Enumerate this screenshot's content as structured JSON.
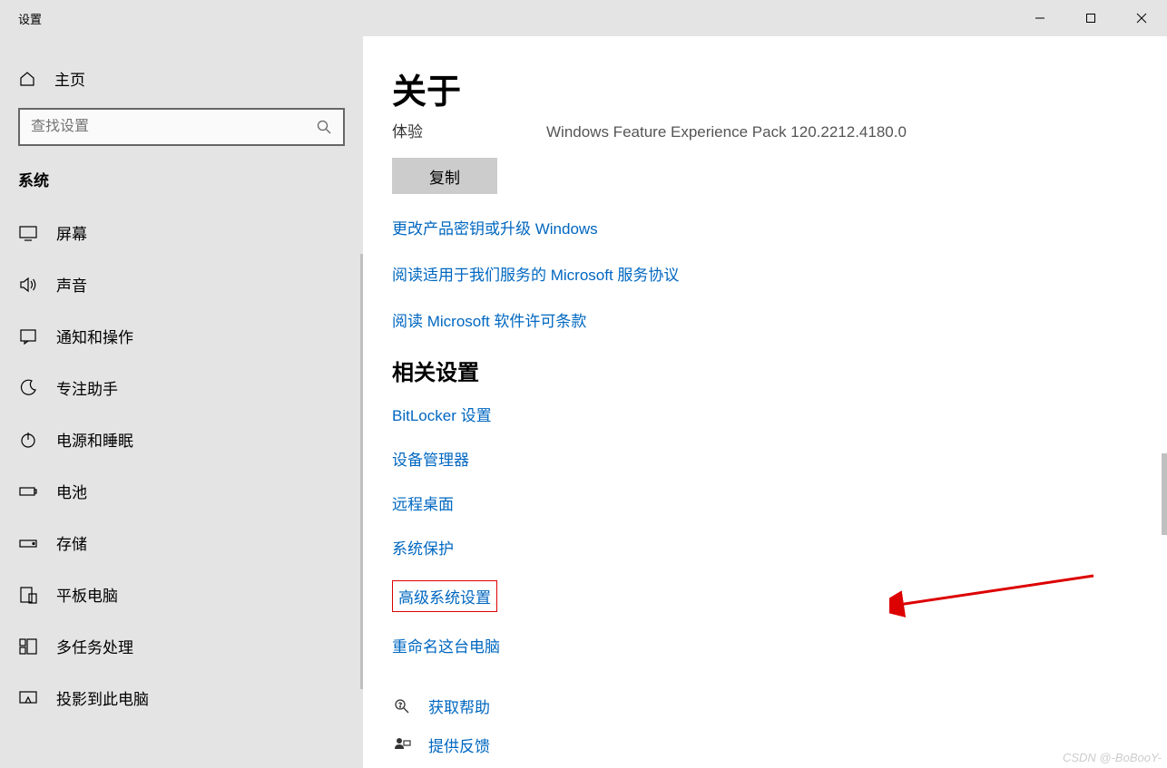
{
  "window": {
    "title": "设置"
  },
  "sidebar": {
    "home": "主页",
    "search_placeholder": "查找设置",
    "section": "系统",
    "items": [
      {
        "label": "屏幕"
      },
      {
        "label": "声音"
      },
      {
        "label": "通知和操作"
      },
      {
        "label": "专注助手"
      },
      {
        "label": "电源和睡眠"
      },
      {
        "label": "电池"
      },
      {
        "label": "存储"
      },
      {
        "label": "平板电脑"
      },
      {
        "label": "多任务处理"
      },
      {
        "label": "投影到此电脑"
      }
    ]
  },
  "content": {
    "title": "关于",
    "info": {
      "key": "体验",
      "value": "Windows Feature Experience Pack 120.2212.4180.0"
    },
    "copy_label": "复制",
    "links_top": [
      "更改产品密钥或升级 Windows",
      "阅读适用于我们服务的 Microsoft 服务协议",
      "阅读 Microsoft 软件许可条款"
    ],
    "related_heading": "相关设置",
    "related_links": [
      "BitLocker 设置",
      "设备管理器",
      "远程桌面",
      "系统保护",
      "高级系统设置",
      "重命名这台电脑"
    ],
    "help": [
      {
        "label": "获取帮助"
      },
      {
        "label": "提供反馈"
      }
    ]
  },
  "watermark": "CSDN @-BoBooY-"
}
